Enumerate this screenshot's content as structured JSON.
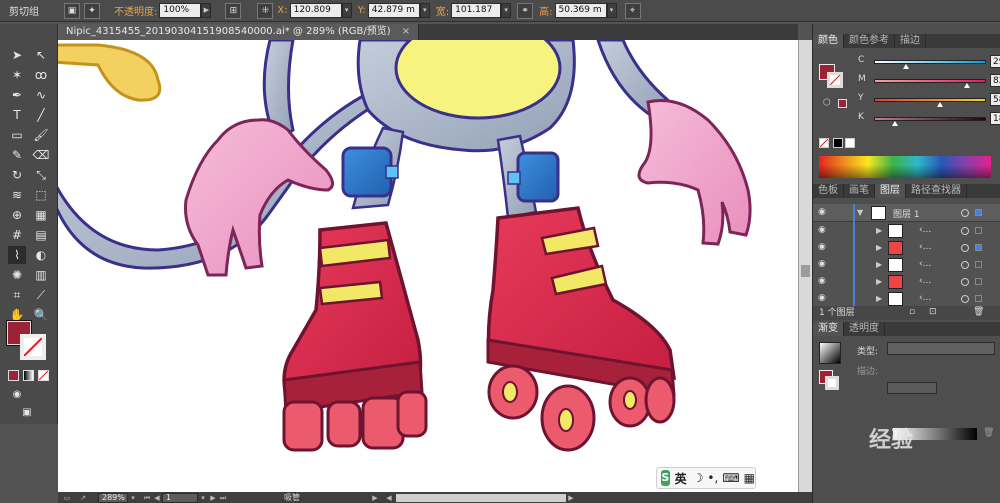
{
  "control_bar": {
    "group_label": "剪切组",
    "opacity_label": "不透明度:",
    "opacity_value": "100%",
    "x_label": "X:",
    "x_value": "120.809",
    "y_label": "Y:",
    "y_value": "42.879 m",
    "width_label": "宽:",
    "width_value": "101.187",
    "height_label": "高:",
    "height_value": "50.369 m"
  },
  "document": {
    "tab_title": "Nipic_4315455_20190304151908540000.ai* @ 289% (RGB/预览)",
    "zoom": "289%",
    "artboard": "1",
    "status_text": "吸管"
  },
  "color_panel": {
    "tabs": [
      "颜色",
      "颜色参考",
      "描边"
    ],
    "active_tab": "颜色",
    "channels": [
      {
        "letter": "C",
        "value": "29.49",
        "fraction": 0.29
      },
      {
        "letter": "M",
        "value": "82.98",
        "fraction": 0.83
      },
      {
        "letter": "Y",
        "value": "58.73",
        "fraction": 0.59
      },
      {
        "letter": "K",
        "value": "18.72",
        "fraction": 0.19
      }
    ],
    "fill_color": "#9b2335"
  },
  "layers_panel": {
    "tabs": [
      "色板",
      "画笔",
      "图层",
      "路径查找器"
    ],
    "active_tab": "图层",
    "layer_name": "图层 1",
    "sublayers": [
      "‹...",
      "‹...",
      "‹...",
      "‹...",
      "‹..."
    ],
    "footer": "1 个图层"
  },
  "gradient_panel": {
    "tabs": [
      "渐变",
      "透明度"
    ],
    "active_tab": "渐变",
    "type_label": "类型:",
    "stroke_label": "描边:"
  },
  "ime": {
    "label": "英"
  },
  "watermark": "经验",
  "colors": {
    "accent_red": "#9b2335",
    "skate_red": "#d8294a",
    "skate_yellow": "#f2e865",
    "limb_gray": "#aeb8c8",
    "hand_pink": "#f0a6cb",
    "pad_blue": "#2f77c9"
  }
}
